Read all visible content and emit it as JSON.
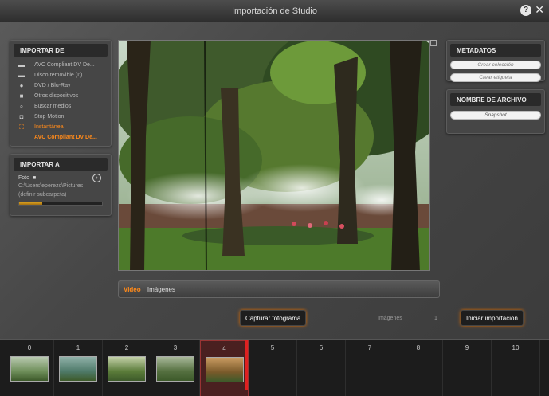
{
  "window": {
    "title": "Importación de Studio"
  },
  "import_from": {
    "header": "IMPORTAR DE",
    "items": [
      {
        "icon": "dv-camera-icon",
        "glyph": "▬",
        "label": "AVC Compliant DV De..."
      },
      {
        "icon": "hard-drive-icon",
        "glyph": "▬",
        "label": "Disco removible (I:)"
      },
      {
        "icon": "disc-icon",
        "glyph": "●",
        "label": "DVD / Blu-Ray"
      },
      {
        "icon": "folder-icon",
        "glyph": "■",
        "label": "Otros dispositivos"
      },
      {
        "icon": "search-icon",
        "glyph": "⌕",
        "label": "Buscar medios"
      },
      {
        "icon": "stop-motion-icon",
        "glyph": "◘",
        "label": "Stop Motion"
      },
      {
        "icon": "snapshot-icon",
        "glyph": "⛶",
        "label": "Instantánea"
      },
      {
        "icon": "",
        "glyph": "",
        "label": "AVC Compliant DV De..."
      }
    ]
  },
  "import_to": {
    "header": "IMPORTAR A",
    "dest_label": "Foto",
    "dest_path": "C:\\Users\\eperezc\\Pictures",
    "dest_note": "(definir subcarpeta)",
    "progress": 0.28
  },
  "metadata": {
    "header": "METADATOS",
    "create_collection": "Crear colección",
    "create_tag": "Crear etiqueta"
  },
  "filename": {
    "header": "NOMBRE DE ARCHIVO",
    "value": "Snapshot"
  },
  "mode_tabs": [
    {
      "label": "Video",
      "active": true
    },
    {
      "label": "Imágenes",
      "active": false
    }
  ],
  "actions": {
    "capture_label": "Capturar fotograma",
    "images_label": "Imágenes",
    "images_count": "1",
    "start_label": "Iniciar importación"
  },
  "timeline": {
    "slots": [
      "0",
      "1",
      "2",
      "3",
      "4",
      "5",
      "6",
      "7",
      "8",
      "9",
      "10"
    ],
    "filled_count": 5,
    "active_index": 4
  },
  "colors": {
    "accent": "#ff8a1a",
    "playhead": "#e02020"
  }
}
